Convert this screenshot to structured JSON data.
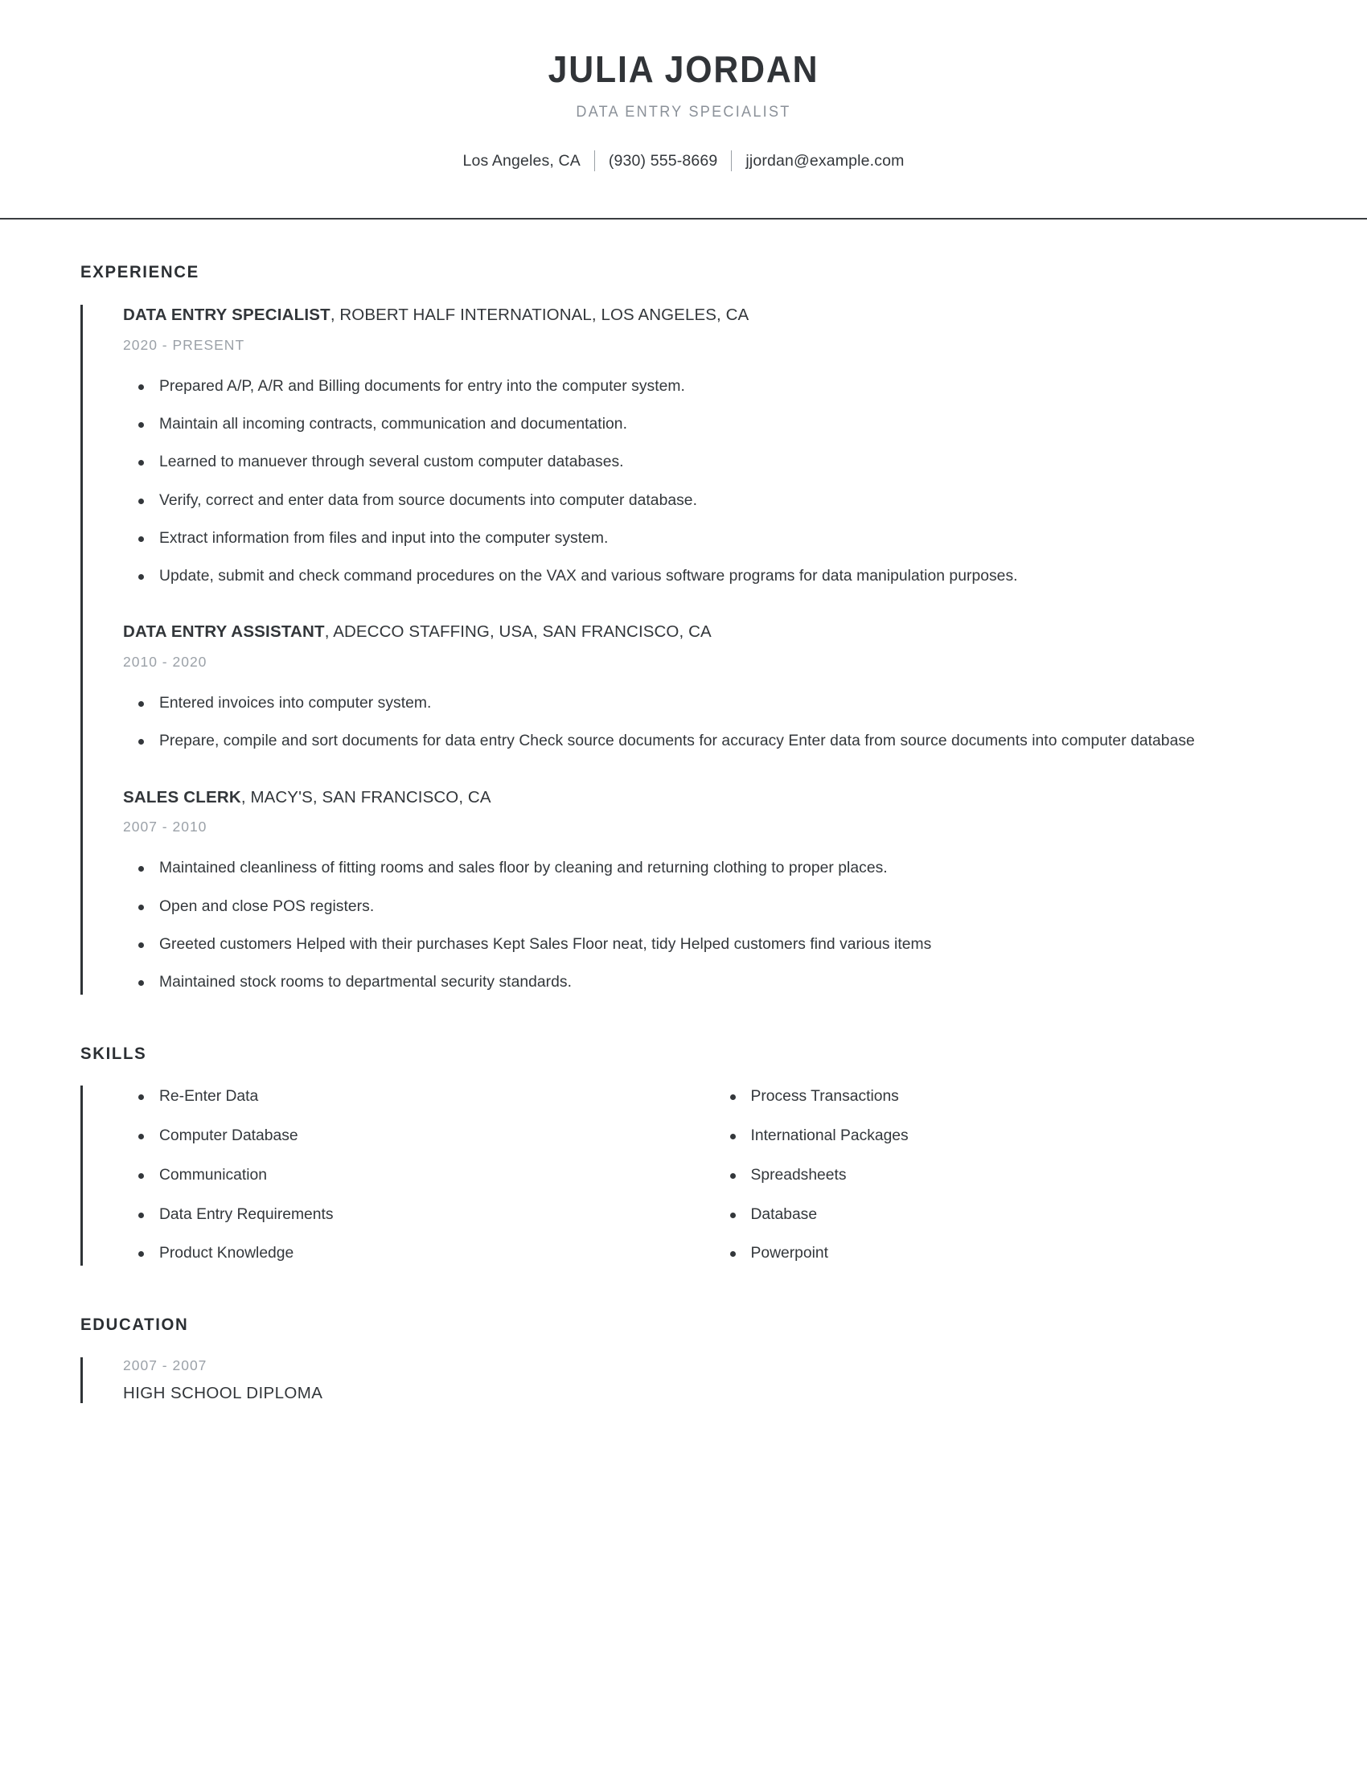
{
  "header": {
    "full_name": "JULIA JORDAN",
    "job_title": "DATA ENTRY SPECIALIST",
    "contact": {
      "location": "Los Angeles, CA",
      "phone": "(930) 555-8669",
      "email": "jjordan@example.com"
    }
  },
  "sections": {
    "experience_title": "EXPERIENCE",
    "skills_title": "SKILLS",
    "education_title": "EDUCATION"
  },
  "experience": [
    {
      "role": "DATA ENTRY SPECIALIST",
      "company": ", ROBERT HALF INTERNATIONAL, LOS ANGELES, CA",
      "dates": "2020 - PRESENT",
      "bullets": [
        "Prepared A/P, A/R and Billing documents for entry into the computer system.",
        "Maintain all incoming contracts, communication and documentation.",
        "Learned to manuever through several custom computer databases.",
        "Verify, correct and enter data from source documents into computer database.",
        "Extract information from files and input into the computer system.",
        "Update, submit and check command procedures on the VAX and various software programs for data manipulation purposes."
      ]
    },
    {
      "role": "DATA ENTRY ASSISTANT",
      "company": ", ADECCO STAFFING, USA, SAN FRANCISCO, CA",
      "dates": "2010 - 2020",
      "bullets": [
        "Entered invoices into computer system.",
        "Prepare, compile and sort documents for data entry Check source documents for accuracy Enter data from source documents into computer database"
      ]
    },
    {
      "role": "SALES CLERK",
      "company": ", MACY'S, SAN FRANCISCO, CA",
      "dates": "2007 - 2010",
      "bullets": [
        "Maintained cleanliness of fitting rooms and sales floor by cleaning and returning clothing to proper places.",
        "Open and close POS registers.",
        "Greeted customers Helped with their purchases Kept Sales Floor neat, tidy Helped customers find various items",
        "Maintained stock rooms to departmental security standards."
      ]
    }
  ],
  "skills": {
    "left_column": [
      "Re-Enter Data",
      "Computer Database",
      "Communication",
      "Data Entry Requirements",
      "Product Knowledge"
    ],
    "right_column": [
      "Process Transactions",
      "International Packages",
      "Spreadsheets",
      "Database",
      "Powerpoint"
    ]
  },
  "education": [
    {
      "dates": "2007 - 2007",
      "degree": "HIGH SCHOOL DIPLOMA"
    }
  ],
  "colors": {
    "text_dark": "#33373b",
    "text_muted": "#9ba1a8",
    "accent_bar": "#2f3337",
    "rule": "#3a3d41"
  }
}
